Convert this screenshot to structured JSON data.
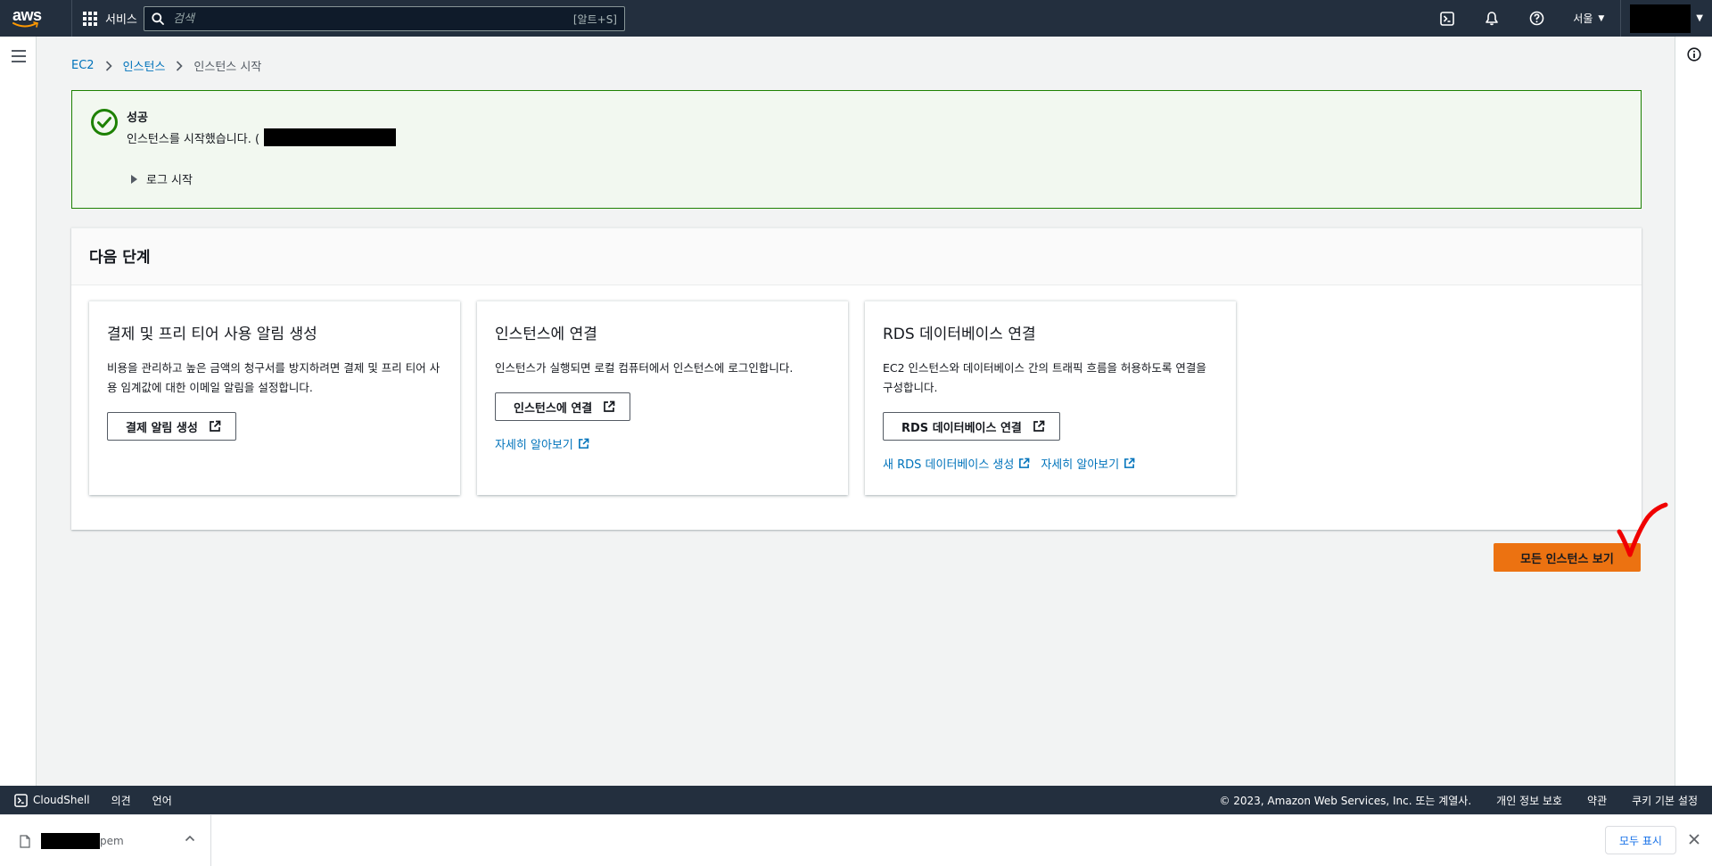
{
  "nav": {
    "logo_text": "aws",
    "services_label": "서비스",
    "search_placeholder": "검색",
    "search_shortcut": "[알트+S]",
    "region_label": "서울",
    "icons": [
      "cloudshell-icon",
      "bell-icon",
      "help-icon"
    ]
  },
  "breadcrumb": {
    "items": [
      "EC2",
      "인스턴스",
      "인스턴스 시작"
    ]
  },
  "flash": {
    "type": "success",
    "title": "성공",
    "message": "인스턴스를 시작했습니다. (",
    "log_label": "로그 시작",
    "color": "#1d8102"
  },
  "next_steps": {
    "title": "다음 단계",
    "cards": [
      {
        "title": "결제 및 프리 티어 사용 알림 생성",
        "description": "비용을 관리하고 높은 금액의 청구서를 방지하려면 결제 및 프리 티어 사용 임계값에 대한 이메일 알림을 설정합니다.",
        "button_label": "결제 알림 생성"
      },
      {
        "title": "인스턴스에 연결",
        "description": "인스턴스가 실행되면 로컬 컴퓨터에서 인스턴스에 로그인합니다.",
        "button_label": "인스턴스에 연결",
        "links": [
          "자세히 알아보기"
        ]
      },
      {
        "title": "RDS 데이터베이스 연결",
        "description": "EC2 인스턴스와 데이터베이스 간의 트래픽 흐름을 허용하도록 연결을 구성합니다.",
        "button_label": "RDS 데이터베이스 연결",
        "links": [
          "새 RDS 데이터베이스 생성",
          "자세히 알아보기"
        ]
      }
    ]
  },
  "primary_button": {
    "label": "모든 인스턴스 보기",
    "color": "#ec7211"
  },
  "footer": {
    "cloudshell_label": "CloudShell",
    "feedback_label": "의견",
    "language_label": "언어",
    "copyright": "© 2023, Amazon Web Services, Inc. 또는 계열사.",
    "privacy_label": "개인 정보 보호",
    "terms_label": "약관",
    "cookie_label": "쿠키 기본 설정"
  },
  "download_bar": {
    "file_suffix": "pem",
    "show_all_label": "모두 표시"
  }
}
